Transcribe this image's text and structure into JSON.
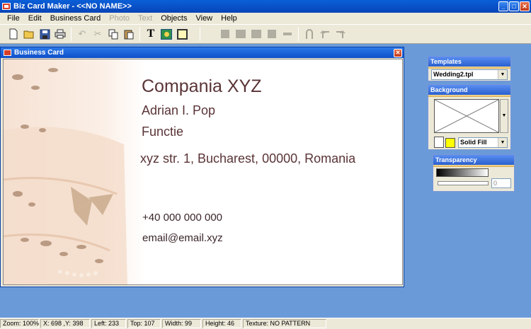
{
  "window": {
    "title": "Biz Card Maker - <<NO NAME>>",
    "minimize": "_",
    "maximize": "□",
    "close": "✕"
  },
  "menu": [
    {
      "label": "File",
      "enabled": true
    },
    {
      "label": "Edit",
      "enabled": true
    },
    {
      "label": "Business Card",
      "enabled": true
    },
    {
      "label": "Photo",
      "enabled": false
    },
    {
      "label": "Text",
      "enabled": false
    },
    {
      "label": "Objects",
      "enabled": true
    },
    {
      "label": "View",
      "enabled": true
    },
    {
      "label": "Help",
      "enabled": true
    }
  ],
  "toolbar": {
    "text_tool_glyph": "T",
    "icons": [
      "new-file-icon",
      "open-folder-icon",
      "save-icon",
      "print-icon",
      "undo-icon",
      "cut-icon",
      "copy-icon",
      "paste-icon",
      "text-tool-icon",
      "picture-tool-icon",
      "frame-tool-icon",
      "align-left-icon",
      "align-center-icon",
      "align-right-icon",
      "align-justify-icon",
      "distribute-icon",
      "arc-up-icon",
      "rotate-left-icon",
      "rotate-right-icon"
    ]
  },
  "child_window": {
    "title": "Business Card",
    "close": "✕"
  },
  "card": {
    "company": "Compania XYZ",
    "name": "Adrian I. Pop",
    "function": "Functie",
    "address": "xyz str. 1, Bucharest, 00000, Romania",
    "phone": "+40 000 000 000",
    "email": "email@email.xyz",
    "text_color": "#5a3436"
  },
  "panels": {
    "templates": {
      "header": "Templates",
      "selected": "Wedding2.tpl"
    },
    "background": {
      "header": "Background",
      "fill": "Solid Fill",
      "color1": "#ffffff",
      "color2": "#ffff00"
    },
    "transparency": {
      "header": "Transparency",
      "value": "0"
    }
  },
  "status": {
    "zoom": "Zoom: 100%",
    "xy": "X: 698 ,Y: 398",
    "left": "Left: 233",
    "top": "Top: 107",
    "width": "Width: 99",
    "height": "Height: 46",
    "texture": "Texture: NO PATTERN"
  }
}
